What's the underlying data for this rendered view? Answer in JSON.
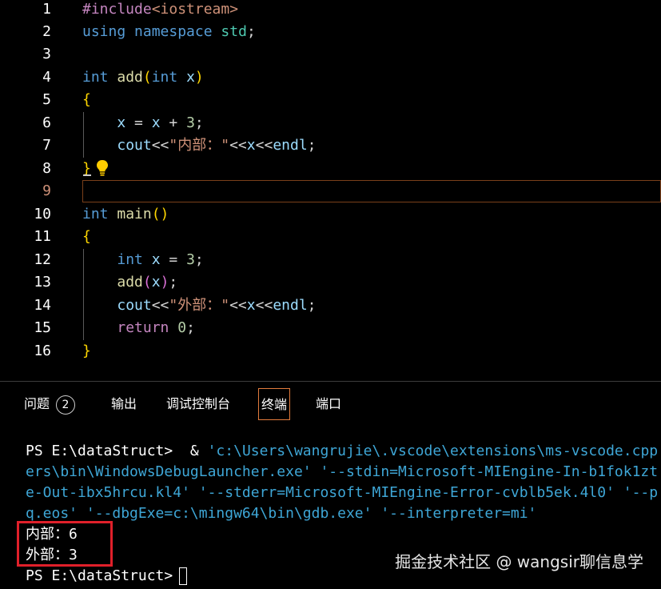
{
  "editor": {
    "active_line": 9,
    "lines": [
      {
        "n": "1",
        "code": "#include<iostream>"
      },
      {
        "n": "2",
        "code": "using namespace std;"
      },
      {
        "n": "3",
        "code": ""
      },
      {
        "n": "4",
        "code": "int add(int x)"
      },
      {
        "n": "5",
        "code": "{"
      },
      {
        "n": "6",
        "code": "    x = x + 3;"
      },
      {
        "n": "7",
        "code": "    cout<<\"内部：\"<<x<<endl;"
      },
      {
        "n": "8",
        "code": "}"
      },
      {
        "n": "9",
        "code": ""
      },
      {
        "n": "10",
        "code": "int main()"
      },
      {
        "n": "11",
        "code": "{"
      },
      {
        "n": "12",
        "code": "    int x = 3;"
      },
      {
        "n": "13",
        "code": "    add(x);"
      },
      {
        "n": "14",
        "code": "    cout<<\"外部：\"<<x<<endl;"
      },
      {
        "n": "15",
        "code": "    return 0;"
      },
      {
        "n": "16",
        "code": "}"
      }
    ],
    "lightbulb_icon": "lightbulb-icon"
  },
  "panel": {
    "tabs": {
      "problems": "问题",
      "problems_count": "2",
      "output": "输出",
      "debug_console": "调试控制台",
      "terminal": "终端",
      "ports": "端口"
    },
    "active_tab": "终端"
  },
  "terminal": {
    "cmd_prompt": "PS E:\\dataStruct>",
    "cmd_amp": "  & ",
    "cmd_line1": "'c:\\Users\\wangrujie\\.vscode\\extensions\\ms-vscode.cpp",
    "cmd_line2": "ers\\bin\\WindowsDebugLauncher.exe' '--stdin=Microsoft-MIEngine-In-b1fok1zt",
    "cmd_line3": "e-Out-ibx5hrcu.kl4' '--stderr=Microsoft-MIEngine-Error-cvblb5ek.4l0' '--p",
    "cmd_line4": "q.eos' '--dbgExe=c:\\mingw64\\bin\\gdb.exe' '--interpreter=mi'",
    "output1": "内部：6",
    "output2": "外部：3",
    "final_prompt": "PS E:\\dataStruct>"
  },
  "watermark": "掘金技术社区 @ wangsir聊信息学",
  "colors": {
    "background": "#000000",
    "keyword": "#569cd6",
    "function": "#dcdcaa",
    "variable": "#9cdcfe",
    "string": "#ce9178",
    "number": "#b5cea8",
    "terminal_path": "#3ea6d6",
    "highlight_box": "#e0202a",
    "active_tab_border": "#e27b3c"
  }
}
